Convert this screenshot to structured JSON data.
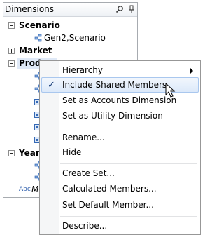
{
  "panel": {
    "title": "Dimensions",
    "icons": [
      "search-icon",
      "pin-icon"
    ]
  },
  "tree": {
    "scenario": {
      "label": "Scenario",
      "child": "Gen2,Scenario"
    },
    "market": {
      "label": "Market"
    },
    "product": {
      "label": "Product"
    },
    "year": {
      "label": "Year"
    },
    "attribute_partial": "M"
  },
  "menu": {
    "items": [
      {
        "label": "Hierarchy",
        "submenu": true
      },
      {
        "label": "Include Shared Members",
        "checked": true,
        "hover": true
      },
      {
        "label": "Set as Accounts Dimension"
      },
      {
        "label": "Set as Utility Dimension"
      },
      {
        "label": "Rename..."
      },
      {
        "label": "Hide"
      },
      {
        "label": "Create Set..."
      },
      {
        "label": "Calculated Members..."
      },
      {
        "label": "Set Default Member..."
      },
      {
        "label": "Describe..."
      }
    ],
    "check_glyph": "✓"
  },
  "colors": {
    "selection": "#dfe9f7",
    "hover_border": "#a9c7ee",
    "member_icon": "#3569b5"
  }
}
